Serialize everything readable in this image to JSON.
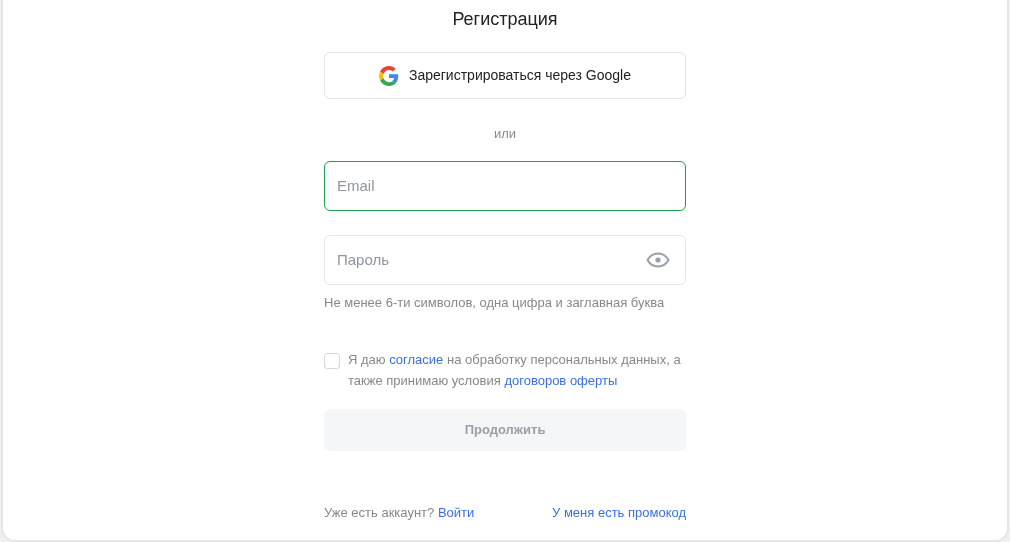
{
  "title": "Регистрация",
  "google_button": {
    "label": "Зарегистрироваться через Google"
  },
  "divider": "или",
  "email": {
    "placeholder": "Email",
    "focused": true
  },
  "password": {
    "placeholder": "Пароль",
    "focused": false
  },
  "password_hint": "Не менее 6-ти символов, одна цифра и заглавная буква",
  "consent": {
    "checked": false,
    "parts": [
      {
        "kind": "text",
        "text": "Я даю"
      },
      {
        "kind": "link",
        "text": "согласие"
      },
      {
        "kind": "text",
        "text": "на обработку персональных данных, а также принимаю условия"
      },
      {
        "kind": "link",
        "text": "договоров оферты"
      }
    ]
  },
  "continue_button": {
    "label": "Продолжить",
    "disabled": true
  },
  "footer": {
    "question": "Уже есть аккаунт?",
    "login_link": "Войти",
    "promo_link": "У меня есть промокод"
  }
}
